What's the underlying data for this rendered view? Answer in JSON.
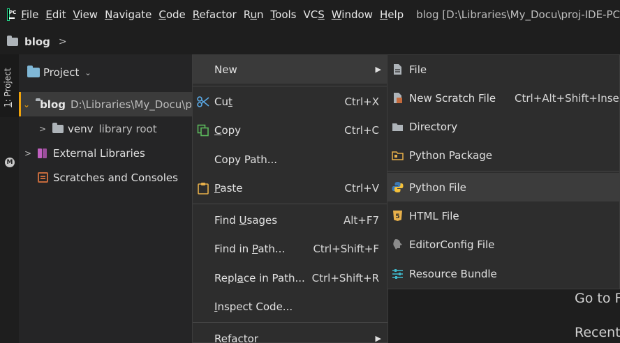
{
  "menubar": {
    "items": [
      "File",
      "Edit",
      "View",
      "Navigate",
      "Code",
      "Refactor",
      "Run",
      "Tools",
      "VCS",
      "Window",
      "Help"
    ],
    "window_title": "blog [D:\\Libraries\\My_Docu\\proj-IDE-PC"
  },
  "breadcrumb": {
    "label": "blog",
    "chevron": ">"
  },
  "left_strip": {
    "tab_label": "1: Project",
    "m_icon": "M"
  },
  "project_panel": {
    "title": "Project",
    "tree": [
      {
        "name": "blog",
        "detail": "D:\\Libraries\\My_Docu\\pr",
        "icon": "folder-icon",
        "expanded": true
      },
      {
        "name": "venv",
        "detail": "library root",
        "icon": "folder-icon",
        "expanded": false
      },
      {
        "name": "External Libraries",
        "detail": "",
        "icon": "library-icon",
        "expanded": false
      },
      {
        "name": "Scratches and Consoles",
        "detail": "",
        "icon": "scratch-icon"
      }
    ]
  },
  "context_menu": {
    "items": [
      {
        "label": "New",
        "shortcut": "",
        "icon": "",
        "submenu": true
      },
      {
        "label": "Cut",
        "shortcut": "Ctrl+X",
        "icon": "scissors-icon"
      },
      {
        "label": "Copy",
        "shortcut": "Ctrl+C",
        "icon": "copy-icon"
      },
      {
        "label": "Copy Path...",
        "shortcut": "",
        "icon": ""
      },
      {
        "label": "Paste",
        "shortcut": "Ctrl+V",
        "icon": "clipboard-icon"
      },
      {
        "label": "Find Usages",
        "shortcut": "Alt+F7",
        "icon": ""
      },
      {
        "label": "Find in Path...",
        "shortcut": "Ctrl+Shift+F",
        "icon": ""
      },
      {
        "label": "Replace in Path...",
        "shortcut": "Ctrl+Shift+R",
        "icon": ""
      },
      {
        "label": "Inspect Code...",
        "shortcut": "",
        "icon": ""
      },
      {
        "label": "Refactor",
        "shortcut": "",
        "icon": "",
        "submenu": true
      }
    ]
  },
  "new_submenu": {
    "items": [
      {
        "label": "File",
        "shortcut": "",
        "icon": "file-icon"
      },
      {
        "label": "New Scratch File",
        "shortcut": "Ctrl+Alt+Shift+Insert",
        "icon": "scratch-file-icon"
      },
      {
        "label": "Directory",
        "shortcut": "",
        "icon": "folder-icon"
      },
      {
        "label": "Python Package",
        "shortcut": "",
        "icon": "package-icon"
      },
      {
        "label": "Python File",
        "shortcut": "",
        "icon": "python-icon",
        "highlighted": true
      },
      {
        "label": "HTML File",
        "shortcut": "",
        "icon": "html-icon"
      },
      {
        "label": "EditorConfig File",
        "shortcut": "",
        "icon": "editorconfig-icon"
      },
      {
        "label": "Resource Bundle",
        "shortcut": "",
        "icon": "resource-bundle-icon"
      }
    ]
  },
  "editor": {
    "goto_text": "Go to F",
    "recent_text": "Recent"
  },
  "colors": {
    "accent_selection": "#f0a30a",
    "highlight": "#3c3c3c",
    "menu_bg": "#2d2d2d"
  }
}
